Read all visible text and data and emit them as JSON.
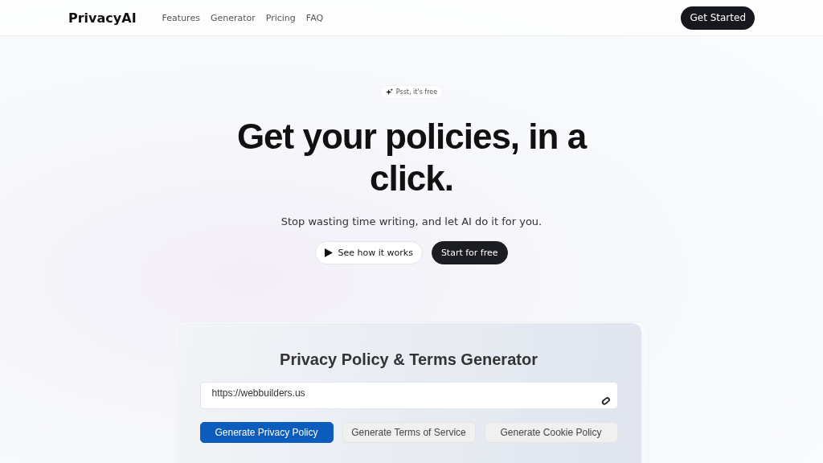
{
  "nav": {
    "logo": "PrivacyAI",
    "links": [
      "Features",
      "Generator",
      "Pricing",
      "FAQ"
    ],
    "cta": "Get Started"
  },
  "hero": {
    "badge": "Psst, it's free",
    "title": "Get your policies, in a click.",
    "subtitle": "Stop wasting time writing, and let AI do it for you.",
    "secondary": "See how it works",
    "primary": "Start for free"
  },
  "generator": {
    "title": "Privacy Policy & Terms Generator",
    "url": "https://webbuilders.us",
    "tabs": [
      {
        "label": "Generate Privacy Policy",
        "selected": true
      },
      {
        "label": "Generate Terms of Service",
        "selected": false
      },
      {
        "label": "Generate Cookie Policy",
        "selected": false
      }
    ]
  }
}
